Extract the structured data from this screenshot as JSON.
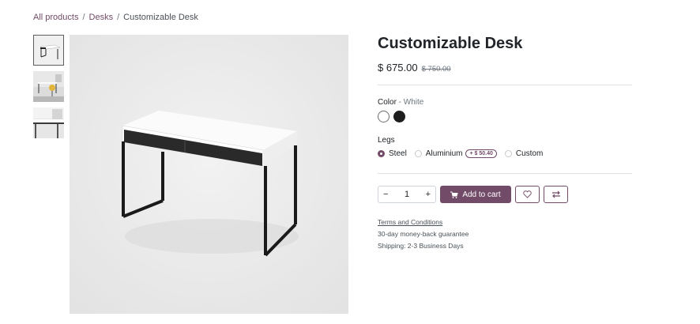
{
  "breadcrumb": {
    "all_products": "All products",
    "category": "Desks",
    "current": "Customizable Desk",
    "separator": "/"
  },
  "product": {
    "name": "Customizable Desk",
    "price": "$ 675.00",
    "old_price": "$ 750.00"
  },
  "color": {
    "label": "Color",
    "selected": " - White",
    "options": [
      "White",
      "Black"
    ]
  },
  "legs": {
    "label": "Legs",
    "options": [
      {
        "label": "Steel",
        "checked": true
      },
      {
        "label": "Aluminium",
        "extra": "+ $ 50.40",
        "checked": false
      },
      {
        "label": "Custom",
        "checked": false
      }
    ]
  },
  "cart": {
    "minus": "−",
    "quantity": "1",
    "plus": "+",
    "add_label": "Add to cart"
  },
  "info": {
    "terms": "Terms and Conditions",
    "guarantee": "30-day money-back guarantee",
    "shipping": "Shipping: 2-3 Business Days"
  },
  "colors": {
    "accent": "#714b67",
    "border": "#dee2e6",
    "muted": "#6c757d"
  },
  "icons": [
    "cart-icon",
    "heart-icon",
    "compare-icon"
  ]
}
